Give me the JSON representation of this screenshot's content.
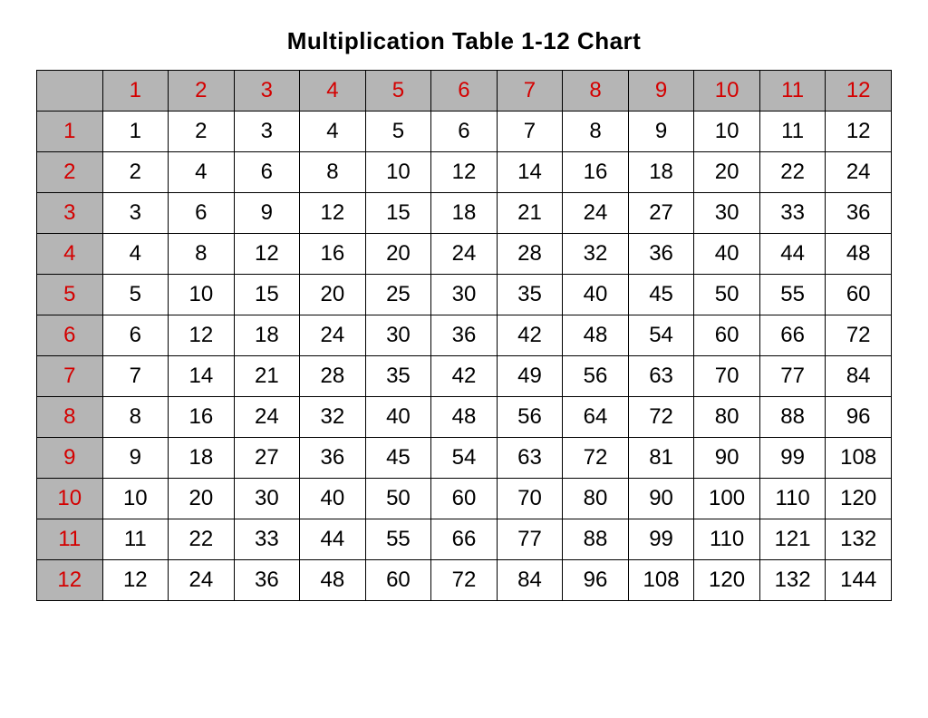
{
  "title": "Multiplication Table 1-12 Chart",
  "chart_data": {
    "type": "table",
    "columns": [
      1,
      2,
      3,
      4,
      5,
      6,
      7,
      8,
      9,
      10,
      11,
      12
    ],
    "rows": [
      1,
      2,
      3,
      4,
      5,
      6,
      7,
      8,
      9,
      10,
      11,
      12
    ],
    "values": [
      [
        1,
        2,
        3,
        4,
        5,
        6,
        7,
        8,
        9,
        10,
        11,
        12
      ],
      [
        2,
        4,
        6,
        8,
        10,
        12,
        14,
        16,
        18,
        20,
        22,
        24
      ],
      [
        3,
        6,
        9,
        12,
        15,
        18,
        21,
        24,
        27,
        30,
        33,
        36
      ],
      [
        4,
        8,
        12,
        16,
        20,
        24,
        28,
        32,
        36,
        40,
        44,
        48
      ],
      [
        5,
        10,
        15,
        20,
        25,
        30,
        35,
        40,
        45,
        50,
        55,
        60
      ],
      [
        6,
        12,
        18,
        24,
        30,
        36,
        42,
        48,
        54,
        60,
        66,
        72
      ],
      [
        7,
        14,
        21,
        28,
        35,
        42,
        49,
        56,
        63,
        70,
        77,
        84
      ],
      [
        8,
        16,
        24,
        32,
        40,
        48,
        56,
        64,
        72,
        80,
        88,
        96
      ],
      [
        9,
        18,
        27,
        36,
        45,
        54,
        63,
        72,
        81,
        90,
        99,
        108
      ],
      [
        10,
        20,
        30,
        40,
        50,
        60,
        70,
        80,
        90,
        100,
        110,
        120
      ],
      [
        11,
        22,
        33,
        44,
        55,
        66,
        77,
        88,
        99,
        110,
        121,
        132
      ],
      [
        12,
        24,
        36,
        48,
        60,
        72,
        84,
        96,
        108,
        120,
        132,
        144
      ]
    ]
  }
}
